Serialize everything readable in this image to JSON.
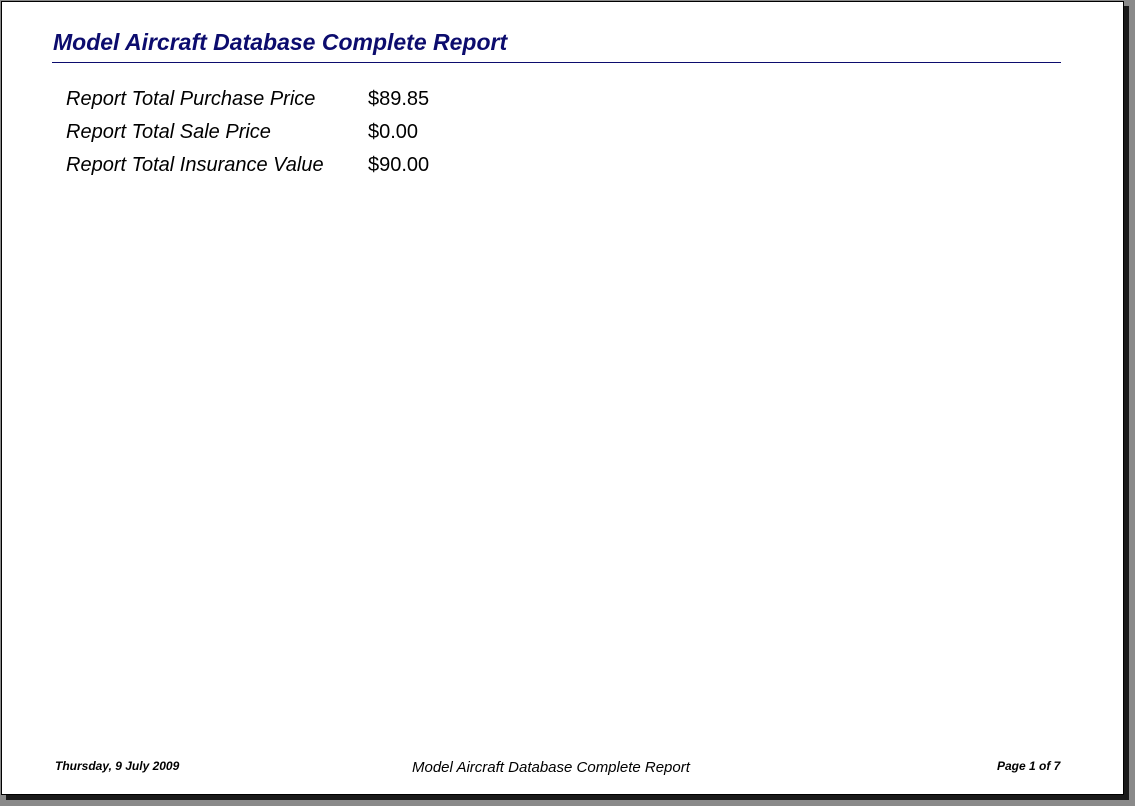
{
  "colors": {
    "title": "#0c0c6e",
    "rule": "#0c0c6e"
  },
  "header": {
    "title": "Model Aircraft Database Complete Report"
  },
  "totals": [
    {
      "label": "Report Total Purchase Price",
      "value": "$89.85"
    },
    {
      "label": "Report Total Sale Price",
      "value": "$0.00"
    },
    {
      "label": "Report Total Insurance Value",
      "value": "$90.00"
    }
  ],
  "footer": {
    "date": "Thursday, 9 July 2009",
    "title": "Model Aircraft Database Complete Report",
    "page": "Page 1 of 7"
  }
}
